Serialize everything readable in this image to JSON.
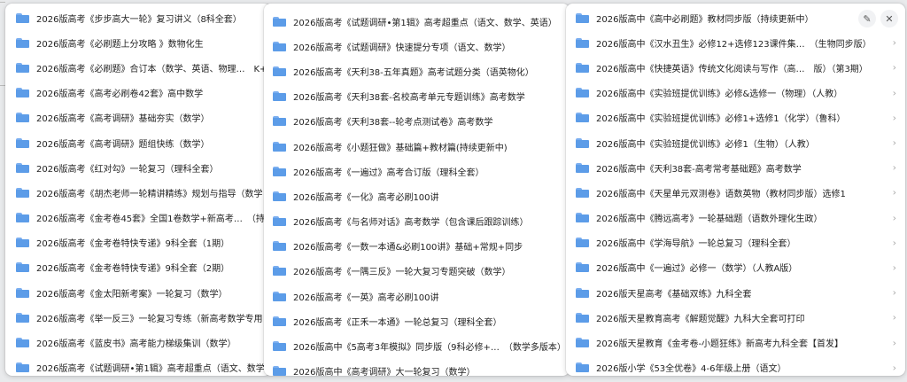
{
  "panels": [
    {
      "items": [
        "2026版高考《步步高大一轮》复习讲义（8科全套）",
        "2026版高考《必刷题上分攻略 》数物化生",
        "2026版高考《必刷题》合订本（数学、英语、物理…　K+",
        "2026版高考《高考必刷卷42套》高中数学",
        "2026版高考《高考调研》基础夯实（数学）",
        "2026版高考《高考调研》题组快练（数学）",
        "2026版高考《红对勾》一轮复习（理科全套）",
        "2026版高考《胡杰老师一轮精讲精练》规划与指导（数学",
        "2026版高考《金考卷45套》全国1卷数学+新高考…　（持",
        "2026版高考《金考卷特快专递》9科全套（1期）",
        "2026版高考《金考卷特快专递》9科全套（2期）",
        "2026版高考《金太阳新考案》一轮复习（数学）",
        "2026版高考《举一反三》一轮复习专练（新高考数学专用",
        "2026版高考《蓝皮书》高考能力梯级集训（数学）",
        "2026版高考《试题调研•第1辑》高考超重点（语文、数学"
      ]
    },
    {
      "items": [
        "2026版高考《试题调研•第1辑》高考超重点（语文、数学、英语）",
        "2026版高考《试题调研》快速提分专项（语文、数学）",
        "2026版高考《天利38-五年真题》高考试题分类（语英物化）",
        "2026版高考《天利38套-名校高考单元专题训练》高考数学",
        "2026版高考《天利38套--轮考点测试卷》高考数学",
        "2026版高考《小题狂做》基础篇+教材篇(持续更新中)",
        "2026版高考《一遍过》高考合订版（理科全套）",
        "2026版高考《一化》高考必刷100讲",
        "2026版高考《与名师对话》高考数学（包含课后跟踪训练）",
        "2026版高考《一数一本通&必刷100讲》基础+常规+同步",
        "2026版高考《一隅三反》一轮大复习专题突破（数学）",
        "2026版高考《一英》高考必刷100讲",
        "2026版高考《正禾一本通》一轮总复习（理科全套）",
        "2026版高中《5高考3年模拟》同步版（9科必修+…　（数学多版本）",
        "2026版高中《高考调研》大一轮复习（数学）"
      ]
    },
    {
      "items": [
        "2026版高中《高中必刷题》教材同步版（持续更新中）",
        "2026版高中《汉水丑生》必修12+选修123课件集…　（生物同步版）",
        "2026版高中《快捷英语》传统文化阅读与写作（高…　版）（第3期）",
        "2026版高中《实验班提优训练》必修&选修一（物理）（人教）",
        "2026版高中《实验班提优训练》必修1+选修1（化学）（鲁科）",
        "2026版高中《实验班提优训练》必修1（生物）（人教）",
        "2026版高中《天利38套-高考常考基础题》高考数学",
        "2026版高中《天星单元双测卷》语数英物（教材同步版）选修1",
        "2026版高中《腾远高考》一轮基础题（语数外理化生政）",
        "2026版高中《学海导航》一轮总复习（理科全套）",
        "2026版高中《一遍过》必修一（数学）（人教A版）",
        "2026版天星高考《基础双练》九科全套",
        "2026版天星教育高考《解题觉醒》九科大全套可打印",
        "2026版天星教育《金考卷-小题狂练》新高考九科全套【首发】",
        "2026版小学《53全优卷》4-6年级上册（语文）"
      ]
    }
  ],
  "icons": {
    "folder": "folder-icon",
    "chevron": "chevron-right-icon",
    "edit": "pencil-icon",
    "close": "close-icon"
  },
  "glyphs": {
    "chevron": "›",
    "edit": "✎",
    "close": "✕"
  },
  "colors": {
    "folder": "#5c9ce8",
    "panel_bg": "#ffffff",
    "page_bg": "#e9eaec"
  }
}
